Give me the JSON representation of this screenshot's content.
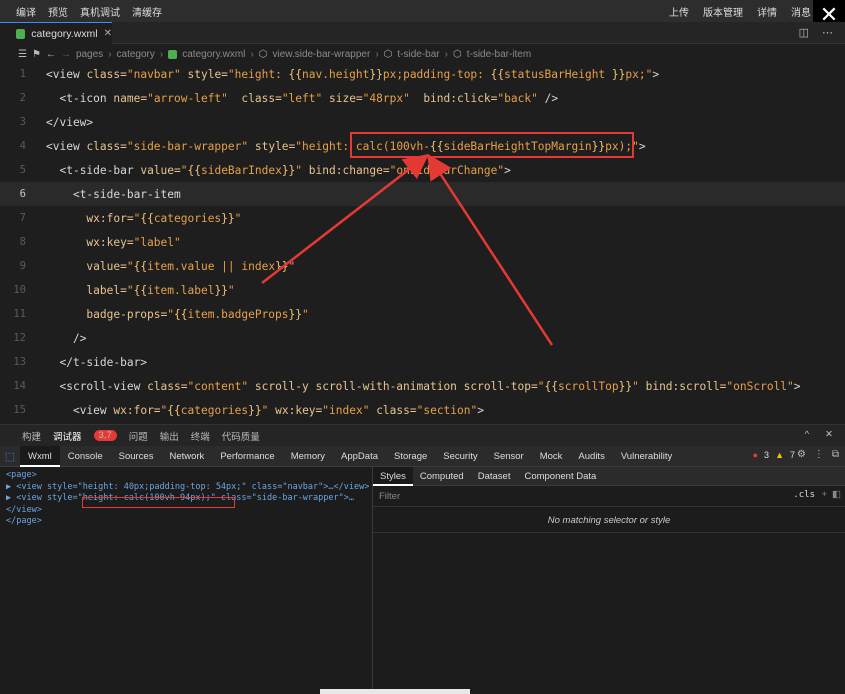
{
  "topbar": {
    "menu": [
      "编译",
      "预览",
      "真机调试",
      "清缓存"
    ],
    "right": [
      "上传",
      "版本管理",
      "详情",
      "消息"
    ],
    "close_glyph": "✕"
  },
  "tab": {
    "filename": "category.wxml",
    "close_glyph": "✕"
  },
  "breadcrumb": [
    "pages",
    "category",
    "category.wxml",
    "view.side-bar-wrapper",
    "t-side-bar",
    "t-side-bar-item"
  ],
  "editor": {
    "lines": [
      {
        "n": "1",
        "html": "<span class='t'>&lt;view</span> <span class='at'>class=</span><span class='str'>\"navbar\"</span> <span class='at'>style=</span><span class='str'>\"height: <span class='br'>{{</span>nav.height<span class='br'>}}</span>px;padding-top: <span class='br'>{{</span>statusBarHeight <span class='br'>}}</span>px;\"</span><span class='t'>&gt;</span>"
      },
      {
        "n": "2",
        "html": "  <span class='t'>&lt;t-icon</span> <span class='at'>name=</span><span class='str'>\"arrow-left\"</span>  <span class='at'>class=</span><span class='str'>\"left\"</span> <span class='at'>size=</span><span class='str'>\"48rpx\"</span>  <span class='at'>bind:click=</span><span class='str'>\"back\"</span> <span class='t'>/&gt;</span>"
      },
      {
        "n": "3",
        "html": "<span class='t'>&lt;/view&gt;</span>"
      },
      {
        "n": "4",
        "html": "<span class='t'>&lt;view</span> <span class='at'>class=</span><span class='str'>\"side-bar-wrapper\"</span> <span class='at'>style=</span><span class='str'>\"height: calc(100vh-<span class='br'>{{</span>sideBarHeightTopMargin<span class='br'>}}</span>px);\"</span><span class='t'>&gt;</span>"
      },
      {
        "n": "5",
        "html": "  <span class='t'>&lt;t-side-bar</span> <span class='at'>value=</span><span class='str'>\"<span class='br'>{{</span>sideBarIndex<span class='br'>}}</span>\"</span> <span class='at'>bind:change=</span><span class='str'>\"onSideBarChange\"</span><span class='t'>&gt;</span>"
      },
      {
        "n": "6",
        "html": "    <span class='t'>&lt;t-side-bar-item</span>"
      },
      {
        "n": "7",
        "html": "      <span class='at'>wx:for=</span><span class='str'>\"<span class='br'>{{</span>categories<span class='br'>}}</span>\"</span>"
      },
      {
        "n": "8",
        "html": "      <span class='at'>wx:key=</span><span class='str'>\"label\"</span>"
      },
      {
        "n": "9",
        "html": "      <span class='at'>value=</span><span class='str'>\"<span class='br'>{{</span>item.value || index<span class='br'>}}</span>\"</span>"
      },
      {
        "n": "10",
        "html": "      <span class='at'>label=</span><span class='str'>\"<span class='br'>{{</span>item.label<span class='br'>}}</span>\"</span>"
      },
      {
        "n": "11",
        "html": "      <span class='at'>badge-props=</span><span class='str'>\"<span class='br'>{{</span>item.badgeProps<span class='br'>}}</span>\"</span>"
      },
      {
        "n": "12",
        "html": "    <span class='t'>/&gt;</span>"
      },
      {
        "n": "13",
        "html": "  <span class='t'>&lt;/t-side-bar&gt;</span>"
      },
      {
        "n": "14",
        "html": "  <span class='t'>&lt;scroll-view</span> <span class='at'>class=</span><span class='str'>\"content\"</span> <span class='at'>scroll-y scroll-with-animation scroll-top=</span><span class='str'>\"<span class='br'>{{</span>scrollTop<span class='br'>}}</span>\"</span> <span class='at'>bind:scroll=</span><span class='str'>\"onScroll\"</span><span class='t'>&gt;</span>"
      },
      {
        "n": "15",
        "html": "    <span class='t'>&lt;view</span> <span class='at'>wx:for=</span><span class='str'>\"<span class='br'>{{</span>categories<span class='br'>}}</span>\"</span> <span class='at'>wx:key=</span><span class='str'>\"index\"</span> <span class='at'>class=</span><span class='str'>\"section\"</span><span class='t'>&gt;</span>"
      }
    ],
    "active_line": "6"
  },
  "devtools_top": {
    "tabs": [
      "构建",
      "调试器",
      "问题",
      "输出",
      "终端",
      "代码质量"
    ],
    "badge": "3,7",
    "controls": [
      "^",
      "✕"
    ]
  },
  "devtools_tabs": [
    "Wxml",
    "Console",
    "Sources",
    "Network",
    "Performance",
    "Memory",
    "AppData",
    "Storage",
    "Security",
    "Sensor",
    "Mock",
    "Audits",
    "Vulnerability"
  ],
  "devtools_counts": {
    "errors": "3",
    "warnings": "7"
  },
  "wxml_tree": [
    "<page>",
    "▶ <view style=\"height: 40px;padding-top: 54px;\" class=\"navbar\">…</view>",
    "▶ <view style=\"height: calc(100vh-94px);\" class=\"side-bar-wrapper\">…",
    "</view>",
    "</page>"
  ],
  "styles_panel": {
    "tabs": [
      "Styles",
      "Computed",
      "Dataset",
      "Component Data"
    ],
    "filter_placeholder": "Filter",
    "cls_label": ".cls",
    "no_match": "No matching selector or style"
  }
}
